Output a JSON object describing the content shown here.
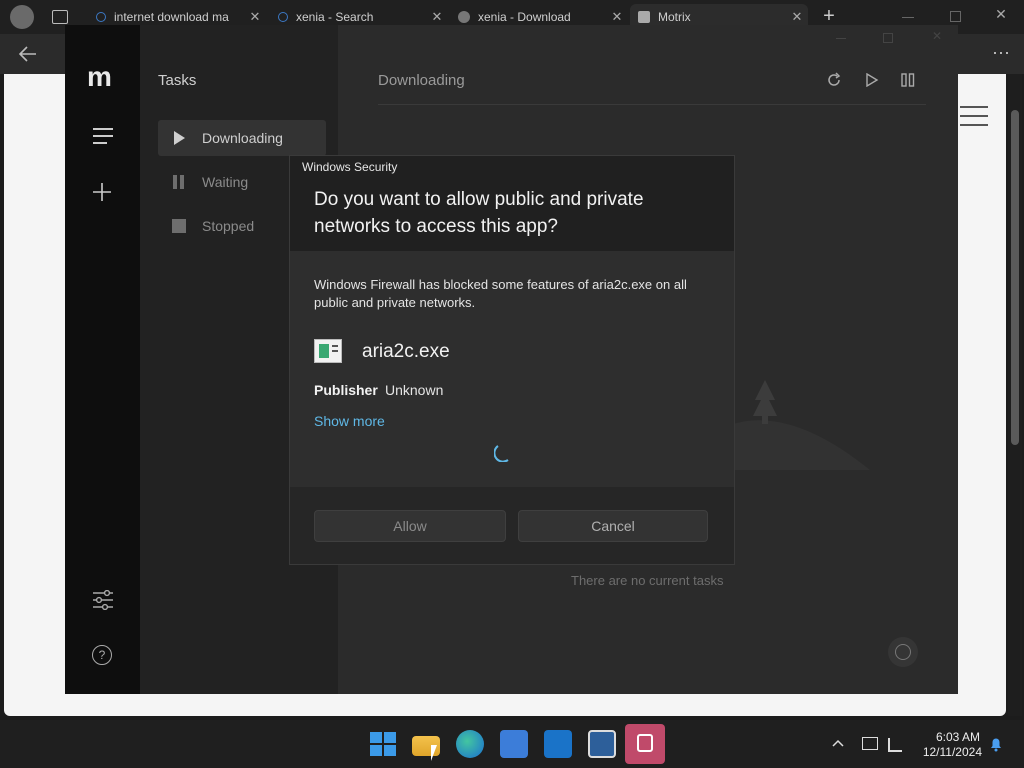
{
  "browser": {
    "tabs": [
      {
        "label": "internet download ma"
      },
      {
        "label": "xenia - Search"
      },
      {
        "label": "xenia - Download"
      },
      {
        "label": "Motrix"
      }
    ],
    "close_glyph": "✕",
    "new_tab_glyph": "+"
  },
  "motrix": {
    "logo": "m",
    "sidebar_title": "Tasks",
    "nav": [
      {
        "label": "Downloading",
        "icon": "play-icon"
      },
      {
        "label": "Waiting",
        "icon": "pause-icon"
      },
      {
        "label": "Stopped",
        "icon": "stop-icon"
      }
    ],
    "main_title": "Downloading",
    "empty_text": "There are no current tasks"
  },
  "dialog": {
    "caption": "Windows Security",
    "heading": "Do you want to allow public and private networks to access this app?",
    "message": "Windows Firewall has blocked some features of aria2c.exe on all public and private networks.",
    "app_name": "aria2c.exe",
    "publisher_label": "Publisher",
    "publisher_value": "Unknown",
    "show_more": "Show more",
    "allow_label": "Allow",
    "cancel_label": "Cancel"
  },
  "taskbar": {
    "time": "6:03 AM",
    "date": "12/11/2024"
  },
  "colors": {
    "link": "#5fb8e6",
    "spinner": "#5fb8e6",
    "taskbar_active": "#c04a6a"
  }
}
